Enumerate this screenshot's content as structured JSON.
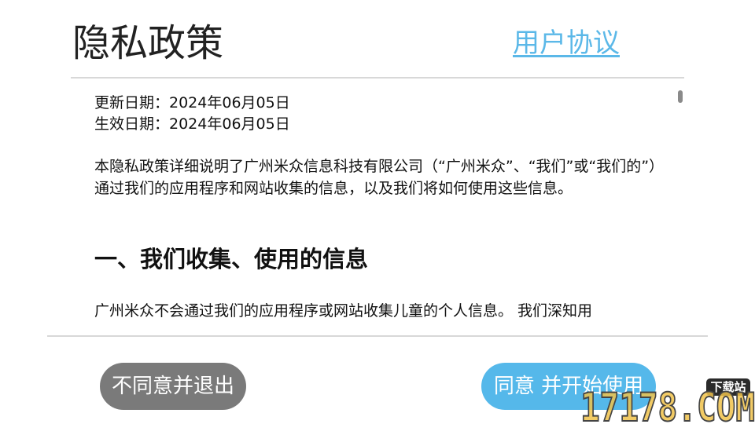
{
  "header": {
    "title": "隐私政策",
    "tab_link": "用户协议"
  },
  "content": {
    "updated_date": "更新日期：2024年06月05日",
    "effective_date": "生效日期：2024年06月05日",
    "intro": "本隐私政策详细说明了广州米众信息科技有限公司（“广州米众”、“我们”或“我们的”）通过我们的应用程序和网站收集的信息，以及我们将如何使用这些信息。",
    "section_heading": "一、我们收集、使用的信息",
    "section_text": "广州米众不会通过我们的应用程序或网站收集儿童的个人信息。 我们深知用"
  },
  "buttons": {
    "decline": "不同意并退出",
    "accept": "同意 并开始使用"
  },
  "watermark": {
    "logo_text": "17178.COM",
    "badge": "下载站"
  },
  "colors": {
    "accent": "#55b8ea",
    "link": "#5bb8e8",
    "decline_button": "#7a7a7a"
  }
}
